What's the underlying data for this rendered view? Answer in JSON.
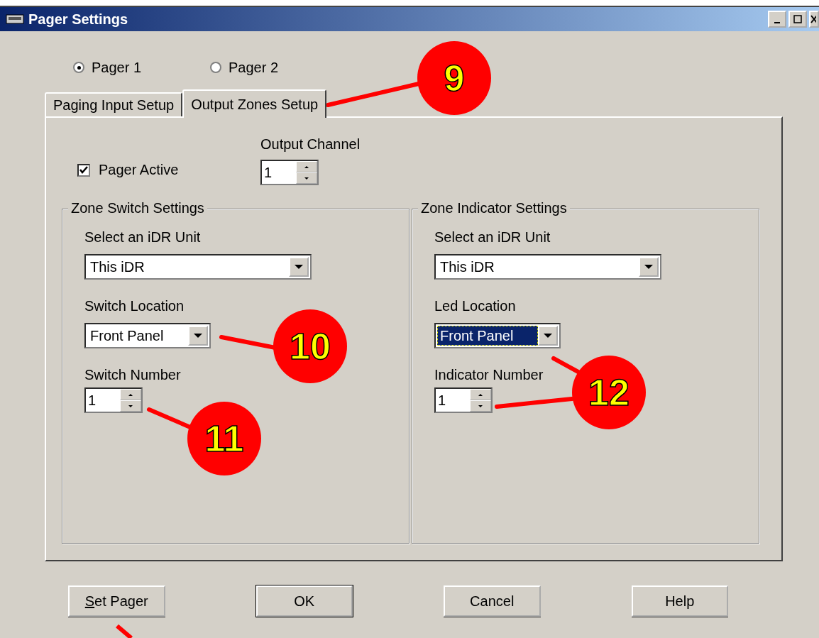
{
  "window": {
    "title": "Pager Settings"
  },
  "pagers": [
    {
      "label": "Pager 1",
      "selected": true
    },
    {
      "label": "Pager 2",
      "selected": false
    }
  ],
  "tabs": [
    {
      "label": "Paging Input Setup",
      "selected": false
    },
    {
      "label": "Output Zones Setup",
      "selected": true
    }
  ],
  "pager_active": {
    "label": "Pager Active",
    "checked": true
  },
  "output_channel": {
    "label": "Output Channel",
    "value": "1"
  },
  "groups": [
    {
      "title": "Zone Switch Settings",
      "unit": {
        "label": "Select an iDR Unit",
        "value": "This iDR"
      },
      "location": {
        "label": "Switch Location",
        "value": "Front Panel",
        "focused": false
      },
      "number": {
        "label": "Switch Number",
        "value": "1"
      }
    },
    {
      "title": "Zone Indicator Settings",
      "unit": {
        "label": "Select an iDR Unit",
        "value": "This iDR"
      },
      "location": {
        "label": "Led Location",
        "value": "Front Panel",
        "focused": true
      },
      "number": {
        "label": "Indicator Number",
        "value": "1"
      }
    }
  ],
  "buttons": [
    {
      "parts": [
        {
          "text": "S",
          "underlined": true
        },
        {
          "text": "et Pager",
          "underlined": false
        }
      ],
      "default": false
    },
    {
      "parts": [
        {
          "text": "OK",
          "underlined": false
        }
      ],
      "default": true
    },
    {
      "parts": [
        {
          "text": "Cancel",
          "underlined": false
        }
      ],
      "default": false
    },
    {
      "parts": [
        {
          "text": "Help",
          "underlined": false
        }
      ],
      "default": false
    }
  ],
  "callouts": [
    {
      "number": "9"
    },
    {
      "number": "10"
    },
    {
      "number": "11"
    },
    {
      "number": "12"
    }
  ]
}
